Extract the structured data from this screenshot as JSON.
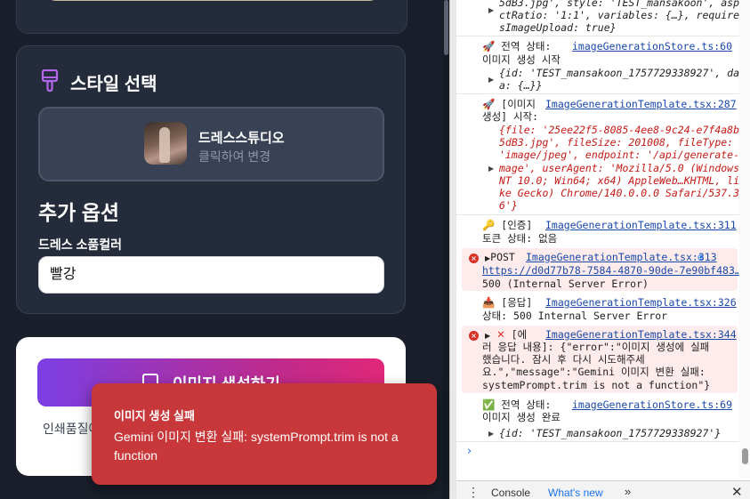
{
  "app": {
    "style_section": {
      "title": "스타일 선택",
      "selected_style": "드레스스튜디오",
      "change_hint": "클릭하여 변경"
    },
    "options_section": {
      "title": "추가 옵션",
      "field_label": "드레스 소품컬러",
      "field_value": "빨강"
    },
    "generate": {
      "button_label": "이미지 생성하기",
      "note": "인쇄품질에"
    },
    "toast": {
      "title": "이미지 생성 실패",
      "message": "Gemini 이미지 변환 실패: systemPrompt.trim is not a function"
    }
  },
  "devtools": {
    "log1_l1": "5dB3.jpg', style: 'TEST_mansakoon', aspe",
    "log1_l2": "ctRatio: '1:1', variables: {…}, require",
    "log1_l3": "sImageUpload: true}",
    "log2_prefix": "전역 상태:",
    "log2_link": "imageGenerationStore.ts:60",
    "log2_text": "이미지 생성 시작",
    "log2_obj_l1": "{id: 'TEST_mansakoon_1757729338927', dat",
    "log2_obj_l2": "a: {…}}",
    "log3_prefix": "[이미지",
    "log3_link": "ImageGenerationTemplate.tsx:287",
    "log3_l2": "생성] 시작:",
    "log3_obj_l1": "{file: '25ee22f5-8085-4ee8-9c24-e7f4a8ba",
    "log3_obj_l2": "5dB3.jpg', fileSize: 201008, fileType:",
    "log3_obj_l3": "'image/jpeg', endpoint: '/api/generate-i",
    "log3_obj_l4": "mage', userAgent: 'Mozilla/5.0 (Windows",
    "log3_obj_l5": "NT 10.0; Win64; x64) AppleWeb…KHTML, li",
    "log3_obj_l6": "ke Gecko) Chrome/140.0.0.0 Safari/537.3",
    "log3_obj_l7": "6'}",
    "log4_prefix": "[인증]",
    "log4_link": "ImageGenerationTemplate.tsx:311",
    "log4_text": "토큰 상태: 없음",
    "err1_method": "POST",
    "err1_link": "ImageGenerationTemplate.tsx:313",
    "err1_url": "https://d0d77b78-7584-4870-90de-7e90bf483…",
    "err1_status": "500 (Internal Server Error)",
    "log5_prefix": "[응답]",
    "log5_link": "ImageGenerationTemplate.tsx:326",
    "log5_text": "상태: 500 Internal Server Error",
    "err2_prefix": "[에",
    "err2_link": "ImageGenerationTemplate.tsx:344",
    "err2_l2": "러 응답 내용]: {\"error\":\"이미지 생성에 실패",
    "err2_l3": "했습니다. 잠시 후 다시 시도해주세",
    "err2_l4": "요.\",\"message\":\"Gemini 이미지 변환 실패:",
    "err2_l5": "systemPrompt.trim is not a function\"}",
    "log6_prefix": "전역 상태:",
    "log6_link": "imageGenerationStore.ts:69",
    "log6_text": "이미지 생성 완료",
    "log6_obj": "{id: 'TEST_mansakoon_1757729338927'}",
    "drawer_tab1": "Console",
    "drawer_tab2": "What's new"
  }
}
